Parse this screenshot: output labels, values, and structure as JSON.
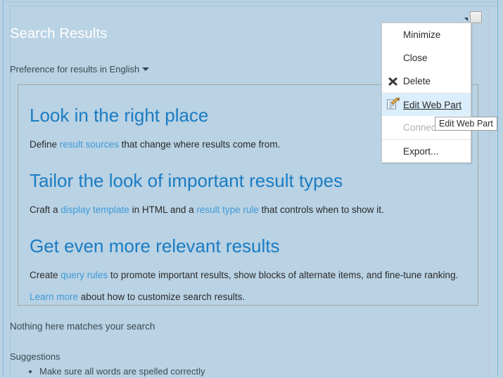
{
  "webpart": {
    "title": "Search Results",
    "language_preference": "Preference for results in English",
    "menu_caret_icon": "caret-down-icon",
    "close_box_icon": "webpart-close-icon"
  },
  "promo": {
    "sections": [
      {
        "heading": "Look in the right place",
        "body_before": "Define ",
        "link": "result sources",
        "body_after": " that change where results come from."
      },
      {
        "heading": "Tailor the look of important result types",
        "body_before": "Craft a ",
        "link": "display template",
        "body_middle": " in HTML and a ",
        "link2": "result type rule",
        "body_after": " that controls when to show it."
      },
      {
        "heading": "Get even more relevant results",
        "body_before": "Create ",
        "link": "query rules",
        "body_after": " to promote important results, show blocks of alternate items, and fine-tune ranking."
      }
    ],
    "learn_more": {
      "link": "Learn more",
      "text": " about how to customize search results."
    }
  },
  "results": {
    "no_match": "Nothing here matches your search",
    "suggestions_title": "Suggestions",
    "suggestions": [
      "Make sure all words are spelled correctly"
    ]
  },
  "context_menu": {
    "items": [
      {
        "label": "Minimize",
        "icon": "",
        "state": "normal"
      },
      {
        "label": "Close",
        "icon": "",
        "state": "normal"
      },
      {
        "label": "Delete",
        "icon": "delete-x-icon",
        "state": "normal"
      },
      {
        "label": "Edit Web Part",
        "icon": "edit-web-part-icon",
        "state": "highlighted"
      },
      {
        "label": "Connections",
        "icon": "",
        "state": "disabled"
      },
      {
        "label": "Export...",
        "icon": "",
        "state": "normal"
      }
    ]
  },
  "tooltip": {
    "text": "Edit Web Part"
  },
  "colors": {
    "page_background": "#b9d2e4",
    "title_text": "#ffffff",
    "heading_link": "#1b7cc2",
    "inline_link": "#3f9ad6",
    "body_text": "#2b2b2b",
    "menu_background": "#ffffff",
    "menu_highlight": "#dbeefb",
    "promo_border": "#a6a6a6"
  }
}
